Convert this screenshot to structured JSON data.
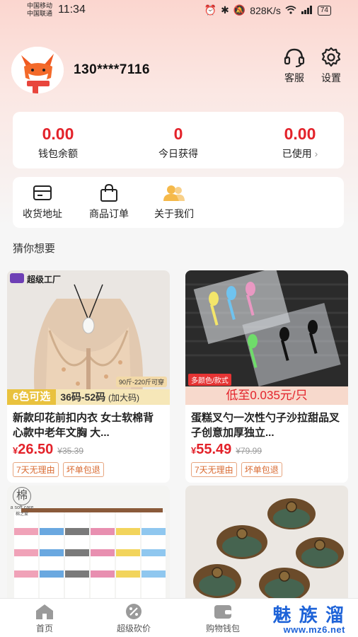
{
  "status_bar": {
    "carrier1": "中国移动",
    "carrier2": "中国联通",
    "time": "11:34",
    "net_speed": "828K/s",
    "signal_label": "4G",
    "battery": "74"
  },
  "profile": {
    "phone": "130****7116",
    "service_label": "客服",
    "settings_label": "设置"
  },
  "wallet": {
    "balance_value": "0.00",
    "balance_label": "钱包余额",
    "today_value": "0",
    "today_label": "今日获得",
    "used_value": "0.00",
    "used_label": "已使用"
  },
  "menu": [
    {
      "label": "收货地址",
      "icon": "address-card-icon"
    },
    {
      "label": "商品订单",
      "icon": "shopping-bag-icon"
    },
    {
      "label": "关于我们",
      "icon": "users-icon"
    }
  ],
  "section_title": "猜你想要",
  "products": [
    {
      "brand_badge": "超级工厂",
      "size_note": "90斤-220斤可穿",
      "banner_left": "6色可选",
      "banner_right": "36码-52码",
      "banner_right_note": "(加大码)",
      "title": "新款印花前扣内衣 女士软棉背心款中老年文胸 大...",
      "price_symbol": "¥",
      "price": "26.50",
      "old_price": "¥35.39",
      "tags": [
        "7天无理由",
        "坏单包退"
      ]
    },
    {
      "corner_badge": "多颜色/款式",
      "banner_text": "低至0.035元/只",
      "title": "蛋糕叉勺一次性勺子沙拉甜品叉子创意加厚独立...",
      "price_symbol": "¥",
      "price": "55.49",
      "old_price": "¥79.99",
      "tags": [
        "7天无理由",
        "坏单包退"
      ]
    },
    {
      "logo_char": "棉",
      "logo_text": "a soft care",
      "logo_sub": "棉之爱"
    },
    {}
  ],
  "tabbar": {
    "home": "首页",
    "bargain": "超级砍价",
    "wallet": "购物钱包"
  },
  "watermark": {
    "big": "魅 族 溜",
    "small": "www.mz6.net"
  },
  "colors": {
    "accent": "#e3222a",
    "header_gradient_top": "#fbd6cf",
    "tag_border": "#e7a57f",
    "watermark": "#1e63d8"
  }
}
